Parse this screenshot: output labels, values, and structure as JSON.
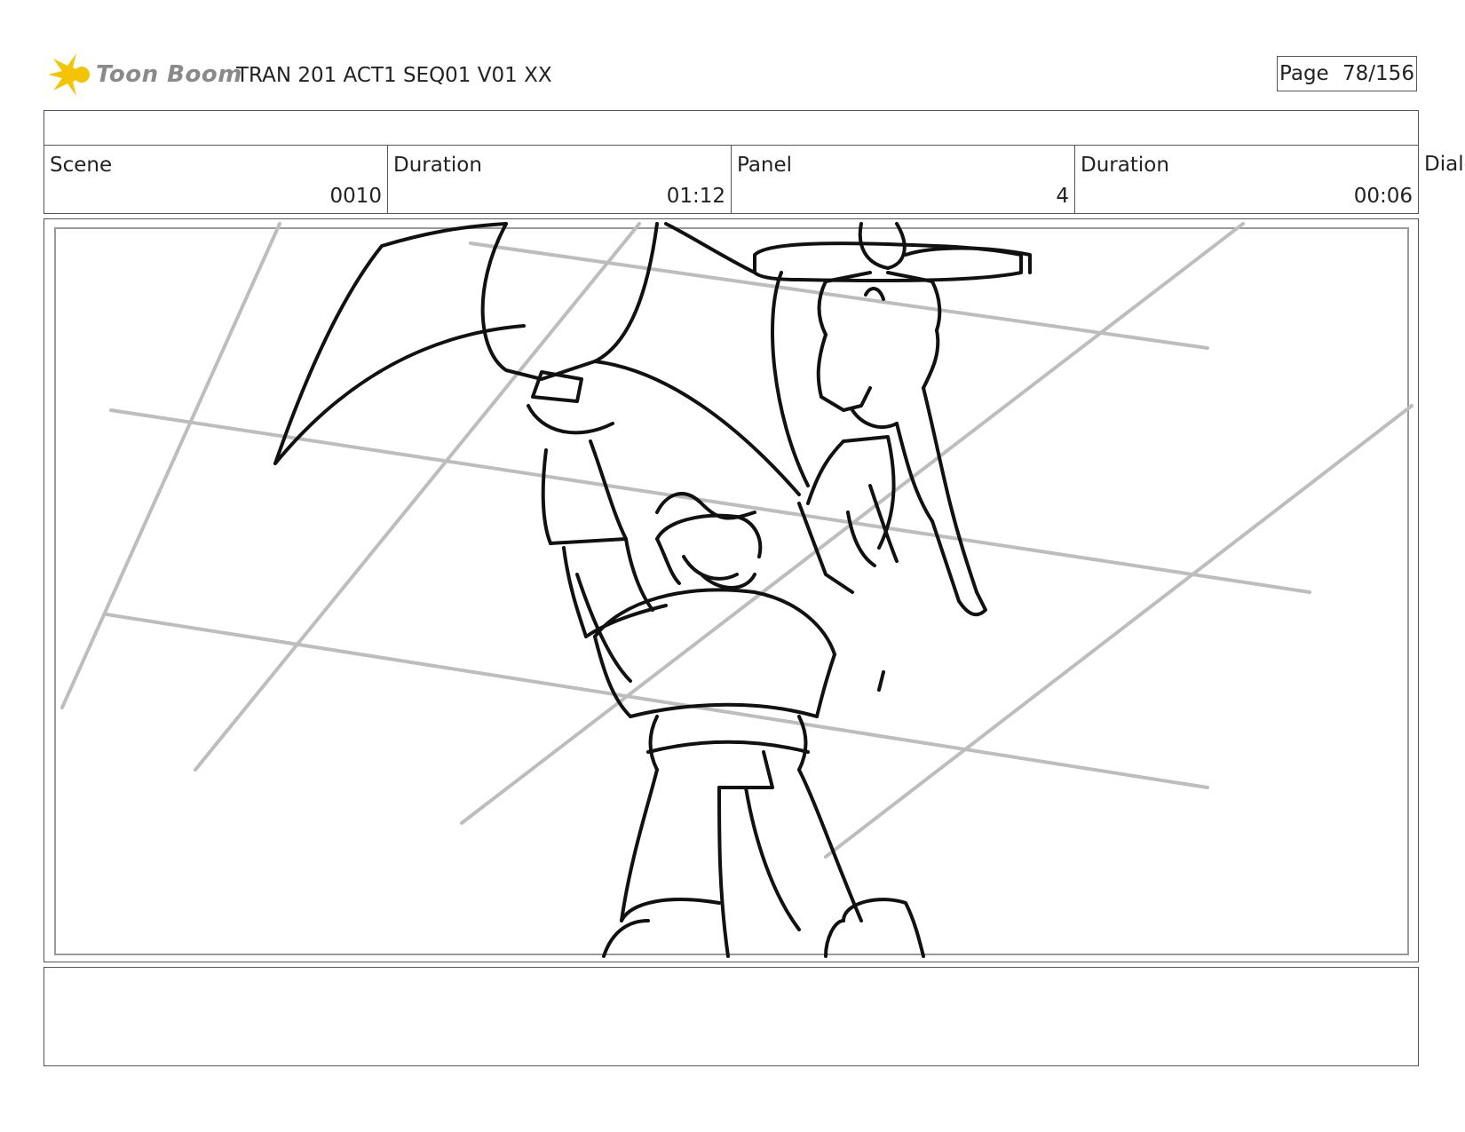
{
  "header": {
    "brand_name": "Toon Boom",
    "document_title": "TRAN 201 ACT1 SEQ01 V01 XX",
    "page_label": "Page",
    "page_number": "78/156"
  },
  "info": {
    "scene_label": "Scene",
    "scene_value": "0010",
    "scene_duration_label": "Duration",
    "scene_duration_value": "01:12",
    "panel_label": "Panel",
    "panel_value": "4",
    "panel_duration_label": "Duration",
    "panel_duration_value": "00:06",
    "dialog_label": "Dialo"
  },
  "colors": {
    "logo_yellow": "#f5c400",
    "logo_text_gray": "#8a8a8a",
    "border_gray": "#555555",
    "guide_gray": "#bdbdbd",
    "sketch_black": "#111111"
  },
  "icons": {
    "logo": "toon-boom-star-icon"
  }
}
